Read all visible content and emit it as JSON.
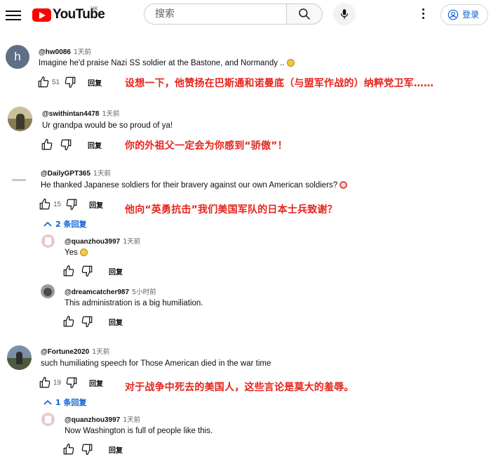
{
  "header": {
    "logo_text": "YouTube",
    "region": "HK",
    "search_placeholder": "搜索",
    "signin_label": "登录"
  },
  "comments": [
    {
      "author": "@hw0086",
      "time": "1天前",
      "text": "Imagine he'd praise Nazi SS soldier at the Bastone, and Normandy ..",
      "emoji": "grimacing-emoji",
      "likes": "51",
      "reply_label": "回复",
      "avatar_letter": "h",
      "avatar_color": "#5f6f86",
      "translation": "设想一下，他赞扬在巴斯通和诺曼底（与盟军作战的）纳粹党卫军……"
    },
    {
      "author": "@swithintan4478",
      "time": "1天前",
      "text": "Ur  grandpa would be so proud of ya!",
      "likes": "",
      "reply_label": "回复",
      "translation": "你的外祖父一定会为你感到“骄傲”！"
    },
    {
      "author": "@DailyGPT365",
      "time": "1天前",
      "text": "He thanked Japanese soldiers for their bravery against our own American soldiers?",
      "emoji": "clown-emoji",
      "likes": "15",
      "reply_label": "回复",
      "translation": "他向“英勇抗击”我们美国军队的日本士兵致谢？",
      "replies_toggle": "2 条回复",
      "replies": [
        {
          "author": "@quanzhou3997",
          "time": "1天前",
          "text": "Yes",
          "emoji": "laughing-emoji",
          "reply_label": "回复"
        },
        {
          "author": "@dreamcatcher987",
          "time": "5小时前",
          "text": "This administration is a big humiliation.",
          "reply_label": "回复"
        }
      ]
    },
    {
      "author": "@Fortune2020",
      "time": "1天前",
      "text": "such humiliating speech for Those American died in the war time",
      "likes": "19",
      "reply_label": "回复",
      "translation": "对于战争中死去的美国人，这些言论是莫大的羞辱。",
      "replies_toggle": "1 条回复",
      "replies": [
        {
          "author": "@quanzhou3997",
          "time": "1天前",
          "text": "Now Washington is full of people like this.",
          "reply_label": "回复"
        }
      ]
    }
  ],
  "colors": {
    "translation_red": "#e6241c",
    "link_blue": "#065fd4",
    "youtube_red": "#ff0000"
  }
}
